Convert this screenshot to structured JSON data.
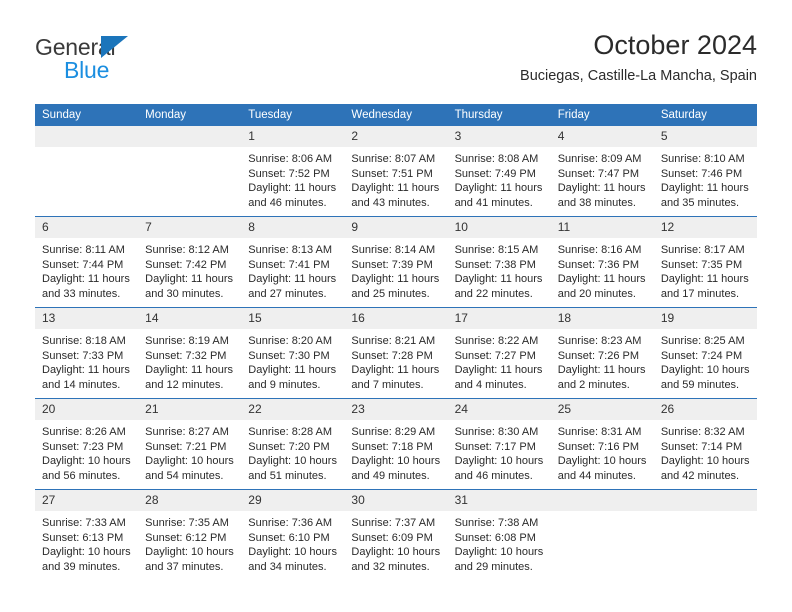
{
  "brand": {
    "line1": "General",
    "line2": "Blue",
    "triangle_color": "#1b75bb",
    "blue_text_color": "#1b8ee0"
  },
  "header": {
    "title": "October 2024",
    "subtitle": "Buciegas, Castille-La Mancha, Spain",
    "accent_color": "#2e73b8",
    "daynum_band_color": "#efefef"
  },
  "weekday_headers": [
    "Sunday",
    "Monday",
    "Tuesday",
    "Wednesday",
    "Thursday",
    "Friday",
    "Saturday"
  ],
  "labels": {
    "sunrise": "Sunrise:",
    "sunset": "Sunset:",
    "daylight": "Daylight:"
  },
  "weeks": [
    [
      {
        "day": "",
        "empty": true
      },
      {
        "day": "",
        "empty": true
      },
      {
        "day": "1",
        "sunrise": "Sunrise: 8:06 AM",
        "sunset": "Sunset: 7:52 PM",
        "daylight1": "Daylight: 11 hours",
        "daylight2": "and 46 minutes."
      },
      {
        "day": "2",
        "sunrise": "Sunrise: 8:07 AM",
        "sunset": "Sunset: 7:51 PM",
        "daylight1": "Daylight: 11 hours",
        "daylight2": "and 43 minutes."
      },
      {
        "day": "3",
        "sunrise": "Sunrise: 8:08 AM",
        "sunset": "Sunset: 7:49 PM",
        "daylight1": "Daylight: 11 hours",
        "daylight2": "and 41 minutes."
      },
      {
        "day": "4",
        "sunrise": "Sunrise: 8:09 AM",
        "sunset": "Sunset: 7:47 PM",
        "daylight1": "Daylight: 11 hours",
        "daylight2": "and 38 minutes."
      },
      {
        "day": "5",
        "sunrise": "Sunrise: 8:10 AM",
        "sunset": "Sunset: 7:46 PM",
        "daylight1": "Daylight: 11 hours",
        "daylight2": "and 35 minutes."
      }
    ],
    [
      {
        "day": "6",
        "sunrise": "Sunrise: 8:11 AM",
        "sunset": "Sunset: 7:44 PM",
        "daylight1": "Daylight: 11 hours",
        "daylight2": "and 33 minutes."
      },
      {
        "day": "7",
        "sunrise": "Sunrise: 8:12 AM",
        "sunset": "Sunset: 7:42 PM",
        "daylight1": "Daylight: 11 hours",
        "daylight2": "and 30 minutes."
      },
      {
        "day": "8",
        "sunrise": "Sunrise: 8:13 AM",
        "sunset": "Sunset: 7:41 PM",
        "daylight1": "Daylight: 11 hours",
        "daylight2": "and 27 minutes."
      },
      {
        "day": "9",
        "sunrise": "Sunrise: 8:14 AM",
        "sunset": "Sunset: 7:39 PM",
        "daylight1": "Daylight: 11 hours",
        "daylight2": "and 25 minutes."
      },
      {
        "day": "10",
        "sunrise": "Sunrise: 8:15 AM",
        "sunset": "Sunset: 7:38 PM",
        "daylight1": "Daylight: 11 hours",
        "daylight2": "and 22 minutes."
      },
      {
        "day": "11",
        "sunrise": "Sunrise: 8:16 AM",
        "sunset": "Sunset: 7:36 PM",
        "daylight1": "Daylight: 11 hours",
        "daylight2": "and 20 minutes."
      },
      {
        "day": "12",
        "sunrise": "Sunrise: 8:17 AM",
        "sunset": "Sunset: 7:35 PM",
        "daylight1": "Daylight: 11 hours",
        "daylight2": "and 17 minutes."
      }
    ],
    [
      {
        "day": "13",
        "sunrise": "Sunrise: 8:18 AM",
        "sunset": "Sunset: 7:33 PM",
        "daylight1": "Daylight: 11 hours",
        "daylight2": "and 14 minutes."
      },
      {
        "day": "14",
        "sunrise": "Sunrise: 8:19 AM",
        "sunset": "Sunset: 7:32 PM",
        "daylight1": "Daylight: 11 hours",
        "daylight2": "and 12 minutes."
      },
      {
        "day": "15",
        "sunrise": "Sunrise: 8:20 AM",
        "sunset": "Sunset: 7:30 PM",
        "daylight1": "Daylight: 11 hours",
        "daylight2": "and 9 minutes."
      },
      {
        "day": "16",
        "sunrise": "Sunrise: 8:21 AM",
        "sunset": "Sunset: 7:28 PM",
        "daylight1": "Daylight: 11 hours",
        "daylight2": "and 7 minutes."
      },
      {
        "day": "17",
        "sunrise": "Sunrise: 8:22 AM",
        "sunset": "Sunset: 7:27 PM",
        "daylight1": "Daylight: 11 hours",
        "daylight2": "and 4 minutes."
      },
      {
        "day": "18",
        "sunrise": "Sunrise: 8:23 AM",
        "sunset": "Sunset: 7:26 PM",
        "daylight1": "Daylight: 11 hours",
        "daylight2": "and 2 minutes."
      },
      {
        "day": "19",
        "sunrise": "Sunrise: 8:25 AM",
        "sunset": "Sunset: 7:24 PM",
        "daylight1": "Daylight: 10 hours",
        "daylight2": "and 59 minutes."
      }
    ],
    [
      {
        "day": "20",
        "sunrise": "Sunrise: 8:26 AM",
        "sunset": "Sunset: 7:23 PM",
        "daylight1": "Daylight: 10 hours",
        "daylight2": "and 56 minutes."
      },
      {
        "day": "21",
        "sunrise": "Sunrise: 8:27 AM",
        "sunset": "Sunset: 7:21 PM",
        "daylight1": "Daylight: 10 hours",
        "daylight2": "and 54 minutes."
      },
      {
        "day": "22",
        "sunrise": "Sunrise: 8:28 AM",
        "sunset": "Sunset: 7:20 PM",
        "daylight1": "Daylight: 10 hours",
        "daylight2": "and 51 minutes."
      },
      {
        "day": "23",
        "sunrise": "Sunrise: 8:29 AM",
        "sunset": "Sunset: 7:18 PM",
        "daylight1": "Daylight: 10 hours",
        "daylight2": "and 49 minutes."
      },
      {
        "day": "24",
        "sunrise": "Sunrise: 8:30 AM",
        "sunset": "Sunset: 7:17 PM",
        "daylight1": "Daylight: 10 hours",
        "daylight2": "and 46 minutes."
      },
      {
        "day": "25",
        "sunrise": "Sunrise: 8:31 AM",
        "sunset": "Sunset: 7:16 PM",
        "daylight1": "Daylight: 10 hours",
        "daylight2": "and 44 minutes."
      },
      {
        "day": "26",
        "sunrise": "Sunrise: 8:32 AM",
        "sunset": "Sunset: 7:14 PM",
        "daylight1": "Daylight: 10 hours",
        "daylight2": "and 42 minutes."
      }
    ],
    [
      {
        "day": "27",
        "sunrise": "Sunrise: 7:33 AM",
        "sunset": "Sunset: 6:13 PM",
        "daylight1": "Daylight: 10 hours",
        "daylight2": "and 39 minutes."
      },
      {
        "day": "28",
        "sunrise": "Sunrise: 7:35 AM",
        "sunset": "Sunset: 6:12 PM",
        "daylight1": "Daylight: 10 hours",
        "daylight2": "and 37 minutes."
      },
      {
        "day": "29",
        "sunrise": "Sunrise: 7:36 AM",
        "sunset": "Sunset: 6:10 PM",
        "daylight1": "Daylight: 10 hours",
        "daylight2": "and 34 minutes."
      },
      {
        "day": "30",
        "sunrise": "Sunrise: 7:37 AM",
        "sunset": "Sunset: 6:09 PM",
        "daylight1": "Daylight: 10 hours",
        "daylight2": "and 32 minutes."
      },
      {
        "day": "31",
        "sunrise": "Sunrise: 7:38 AM",
        "sunset": "Sunset: 6:08 PM",
        "daylight1": "Daylight: 10 hours",
        "daylight2": "and 29 minutes."
      },
      {
        "day": "",
        "empty": true
      },
      {
        "day": "",
        "empty": true
      }
    ]
  ]
}
